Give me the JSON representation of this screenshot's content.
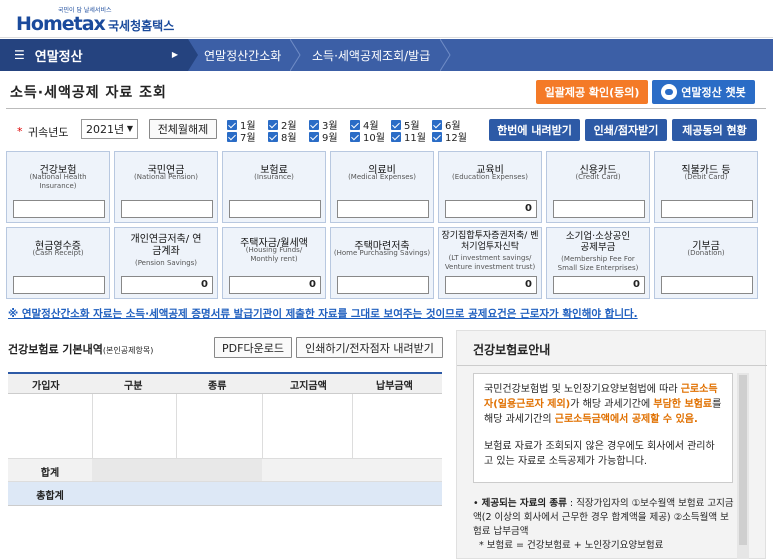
{
  "header": {
    "logo_small": "국민이 담 날세서비스",
    "logo_main": "Hometax",
    "logo_kr": "국세청홈택스"
  },
  "nav": {
    "menu_label": "연말정산",
    "crumb1": "연말정산간소화",
    "crumb2": "소득·세액공제조회/발급"
  },
  "page": {
    "title": "소득·세액공제 자료 조회",
    "btn_consent": "일괄제공 확인(동의)",
    "btn_chatbot": "연말정산 챗봇"
  },
  "filter": {
    "year_label": "귀속년도",
    "year_value": "2021년",
    "btn_select_all": "전체월해제",
    "months_row1": [
      "1월",
      "2월",
      "3월",
      "4월",
      "5월",
      "6월"
    ],
    "months_row2": [
      "7월",
      "8월",
      "9월",
      "10월",
      "11월",
      "12월"
    ],
    "btn_download_once": "한번에 내려받기",
    "btn_print": "인쇄/점자받기",
    "btn_consent_status": "제공동의 현황"
  },
  "cards_row1": [
    {
      "kr": "건강보험",
      "en": "(National Health Insurance)",
      "value": ""
    },
    {
      "kr": "국민연금",
      "en": "(National Pension)",
      "value": ""
    },
    {
      "kr": "보험료",
      "en": "(Insurance)",
      "value": ""
    },
    {
      "kr": "의료비",
      "en": "(Medical Expenses)",
      "value": ""
    },
    {
      "kr": "교육비",
      "en": "(Education Expenses)",
      "value": "0"
    },
    {
      "kr": "신용카드",
      "en": "(Credit Card)",
      "value": ""
    },
    {
      "kr": "직불카드 등",
      "en": "(Debit Card)",
      "value": ""
    }
  ],
  "cards_row2": [
    {
      "kr": "현금영수증",
      "en": "(Cash Receipt)",
      "value": ""
    },
    {
      "kr": "개인연금저축/ 연금계좌",
      "en": "(Pension Savings)",
      "value": "0"
    },
    {
      "kr": "주택자금/월세액",
      "en": "(Housing Funds/ Monthly rent)",
      "value": "0"
    },
    {
      "kr": "주택마련저축",
      "en": "(Home Purchasing Savings)",
      "value": ""
    },
    {
      "kr": "장기집합투자증권저축/ 벤처기업투자신탁",
      "en": "(LT investment savings/ Venture investment trust)",
      "value": "0"
    },
    {
      "kr": "소기업·소상공인 공제부금",
      "en": "(Membership Fee For Small Size Enterprises)",
      "value": "0"
    },
    {
      "kr": "기부금",
      "en": "(Donation)",
      "value": ""
    }
  ],
  "notice": "※ 연말정산간소화 자료는 소득·세액공제 증명서류 발급기관이 제출한 자료를 그대로 보여주는 것이므로 공제요건은 근로자가 확인해야 합니다.",
  "detail": {
    "title": "건강보험료 기본내역",
    "title_sub": "(본인공제항목)",
    "btn_pdf": "PDF다운로드",
    "btn_print": "인쇄하기/전자점자 내려받기",
    "columns": [
      "가입자",
      "구분",
      "종류",
      "고지금액",
      "납부금액"
    ],
    "row_sum": "합계",
    "row_total": "총합계"
  },
  "guide": {
    "title": "건강보험료안내",
    "p1_a": "국민건강보험법 및 노인장기요양보험법에 따라 ",
    "p1_b": "근로소득자(일용근로자 제외)",
    "p1_c": "가 해당 과세기간에 ",
    "p1_d": "부담한 보험료",
    "p1_e": "를 해당 과세기간의 ",
    "p1_f": "근로소득금액에서 공제할 수 있음.",
    "p2": "보험료 자료가 조회되지 않은 경우에도 회사에서 관리하고 있는 자료로 소득공제가 가능합니다.",
    "list1_label": "제공되는 자료의 종류",
    "list1_text": " : 직장가입자의 ①보수월액 보험료 고지금액(2 이상의 회사에서 근무한 경우 합계액을 제공) ②소득월액 보험료 납부금액",
    "list2": "* 보험료 = 건강보험료 + 노인장기요양보험료"
  }
}
